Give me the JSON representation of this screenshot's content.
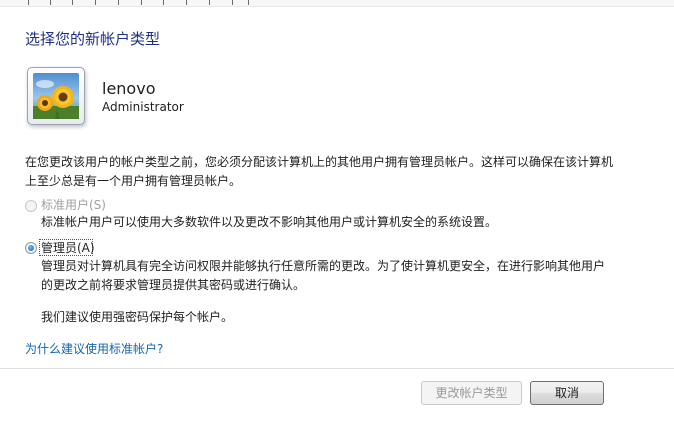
{
  "page": {
    "title": "选择您的新帐户类型"
  },
  "account": {
    "name": "lenovo",
    "role": "Administrator",
    "avatar_icon": "sunflower-avatar-icon"
  },
  "description": "在您更改该用户的帐户类型之前，您必须分配该计算机上的其他用户拥有管理员帐户。这样可以确保在该计算机上至少总是有一个用户拥有管理员帐户。",
  "options": {
    "standard": {
      "label": "标准用户(S)",
      "description": "标准帐户用户可以使用大多数软件以及更改不影响其他用户或计算机安全的系统设置。",
      "selected": false,
      "enabled": false
    },
    "admin": {
      "label": "管理员(A)",
      "description": "管理员对计算机具有完全访问权限并能够执行任意所需的更改。为了使计算机更安全，在进行影响其他用户的更改之前将要求管理员提供其密码或进行确认。",
      "recommendation": "我们建议使用强密码保护每个帐户。",
      "selected": true,
      "enabled": true
    }
  },
  "help_link": "为什么建议使用标准帐户?",
  "buttons": {
    "change_type": "更改帐户类型",
    "cancel": "取消"
  },
  "colors": {
    "title": "#1e3287",
    "link": "#1465b4",
    "disabled_text": "#a0a0a0"
  }
}
